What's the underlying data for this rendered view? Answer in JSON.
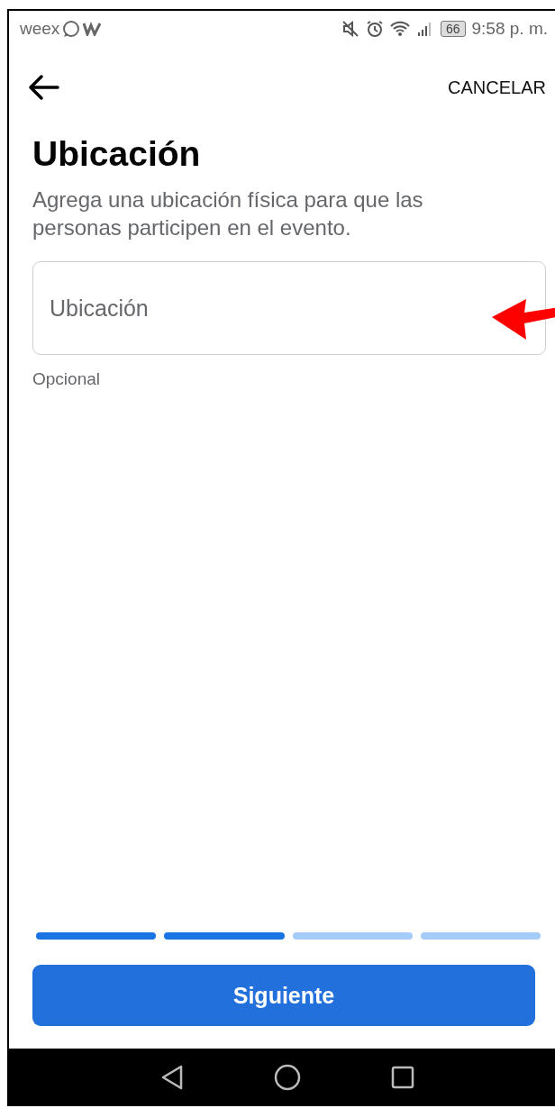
{
  "status_bar": {
    "carrier": "weex",
    "battery": "66",
    "time": "9:58 p. m."
  },
  "header": {
    "action": "CANCELAR"
  },
  "title": "Ubicación",
  "description": "Agrega una ubicación física para que las personas participen en el evento.",
  "location_field": {
    "placeholder": "Ubicación",
    "helper": "Opcional"
  },
  "progress": [
    {
      "done": true
    },
    {
      "done": true
    },
    {
      "done": false
    },
    {
      "done": false
    }
  ],
  "primary_button": "Siguiente"
}
